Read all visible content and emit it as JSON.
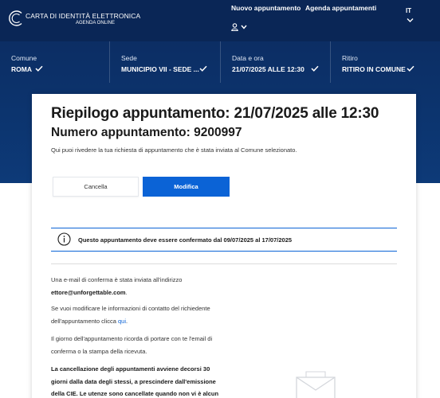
{
  "header": {
    "logo_title": "CARTA DI IDENTITÀ ELETTRONICA",
    "logo_subtitle": "AGENDA ONLINE",
    "nav": {
      "new_appointment": "Nuovo appuntamento",
      "agenda": "Agenda appuntamenti"
    },
    "language": "IT",
    "icons": [
      "cie-logo-icon",
      "user-icon",
      "chevron-down-icon"
    ]
  },
  "steps": [
    {
      "label": "Comune",
      "value": "ROMA"
    },
    {
      "label": "Sede",
      "value": "MUNICIPIO VII - SEDE ..."
    },
    {
      "label": "Data e ora",
      "value": "21/07/2025 ALLE 12:30"
    },
    {
      "label": "Ritiro",
      "value": "RITIRO IN COMUNE"
    }
  ],
  "summary": {
    "title": "Riepilogo appuntamento: 21/07/2025 alle 12:30",
    "number": "Numero appuntamento: 9200997",
    "intro": "Qui puoi rivedere la tua richiesta di appuntamento che è stata inviata al Comune selezionato."
  },
  "actions": {
    "cancel_label": "Cancella",
    "modify_label": "Modifica"
  },
  "notice": {
    "icon": "info-icon",
    "text": "Questo appuntamento deve essere confermato dal 09/07/2025 al 17/07/2025"
  },
  "details": {
    "email_line1": "Una e-mail di conferma è stata inviata all'indirizzo",
    "email_address": "ettore@unforgettable.com",
    "email_suffix": ".",
    "modify_line1": "Se vuoi modificare le informazioni di contatto del richiedente",
    "modify_line2_prefix": "dell'appuntamento clicca ",
    "modify_link": "qui",
    "modify_line2_suffix": ".",
    "reminder_line1": "Il giorno dell'appuntamento ricorda di portare con te l'email di",
    "reminder_line2": "conferma o la stampa della ricevuta.",
    "cancel_line1": "La cancellazione degli appuntamenti avviene decorsi 30",
    "cancel_line2": "giorni dalla data degli stessi, a prescindere dall'emissione",
    "cancel_line3": "della CIE. Le utenze sono cancellate quando non vi è alcun"
  },
  "colors": {
    "header_bg": "#0b2a5e",
    "primary": "#0b63d6"
  }
}
